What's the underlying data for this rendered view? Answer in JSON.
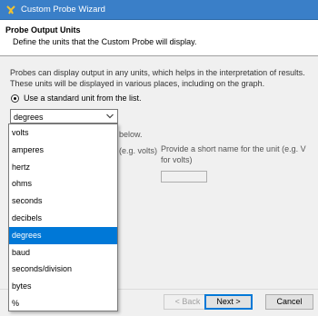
{
  "window": {
    "title": "Custom Probe Wizard"
  },
  "header": {
    "title": "Probe Output Units",
    "subtitle": "Define the units that the Custom Probe will display."
  },
  "description": "Probes can display output in any units, which helps in the interpretation of results. These units will be displayed in various places, including on the graph.",
  "radio_standard": {
    "label": "Use a standard unit from the list.",
    "selected": true
  },
  "combo": {
    "value": "degrees"
  },
  "background_texts": {
    "partial_below": "below.",
    "partial_volts": "(e.g. volts)",
    "short_name_line1": "Provide a short name for the unit (e.g. V",
    "short_name_line2": "for volts)"
  },
  "dropdown": {
    "items": [
      "volts",
      "amperes",
      "hertz",
      "ohms",
      "seconds",
      "decibels",
      "degrees",
      "baud",
      "seconds/division",
      "bytes",
      "%"
    ],
    "selected": "degrees"
  },
  "buttons": {
    "back": "< Back",
    "next": "Next >",
    "cancel": "Cancel"
  },
  "colors": {
    "titlebar": "#3a7fc8",
    "selection": "#0078d7"
  }
}
